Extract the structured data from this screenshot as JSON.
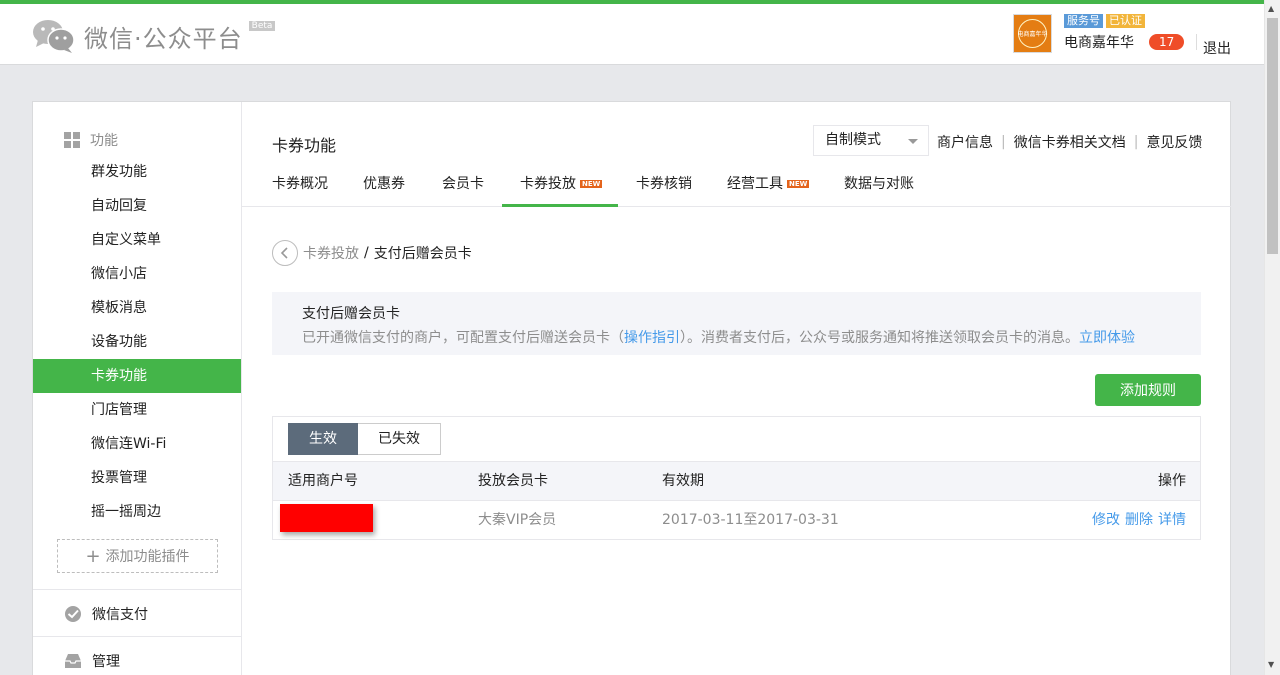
{
  "header": {
    "logo_text": "微信·公众平台",
    "beta": "Beta",
    "avatar_text": "电商嘉年华",
    "badge_service": "服务号",
    "badge_verified": "已认证",
    "account_name": "电商嘉年华",
    "message_count": "17",
    "logout": "退出"
  },
  "sidebar": {
    "section_title": "功能",
    "items": [
      {
        "label": "群发功能"
      },
      {
        "label": "自动回复"
      },
      {
        "label": "自定义菜单"
      },
      {
        "label": "微信小店"
      },
      {
        "label": "模板消息"
      },
      {
        "label": "设备功能"
      },
      {
        "label": "卡券功能"
      },
      {
        "label": "门店管理"
      },
      {
        "label": "微信连Wi-Fi"
      },
      {
        "label": "投票管理"
      },
      {
        "label": "摇一摇周边"
      }
    ],
    "add_plugin": "添加功能插件",
    "pay": "微信支付",
    "manage": "管理"
  },
  "content": {
    "title": "卡券功能",
    "mode_select": "自制模式",
    "links": [
      "商户信息",
      "微信卡券相关文档",
      "意见反馈"
    ],
    "tabs": [
      {
        "label": "卡券概况"
      },
      {
        "label": "优惠券"
      },
      {
        "label": "会员卡"
      },
      {
        "label": "卡券投放"
      },
      {
        "label": "卡券核销"
      },
      {
        "label": "经营工具"
      },
      {
        "label": "数据与对账"
      }
    ],
    "new_tag": "NEW",
    "breadcrumb": {
      "parent": "卡券投放",
      "sep": "/",
      "current": "支付后赠会员卡"
    },
    "info": {
      "title": "支付后赠会员卡",
      "desc_prefix": "已开通微信支付的商户，可配置支付后赠送会员卡（",
      "guide_link": "操作指引",
      "desc_middle": "）。消费者支付后，公众号或服务通知将推送领取会员卡的消息。",
      "try_link": "立即体验"
    },
    "add_rule": "添加规则",
    "filter": {
      "active": "生效",
      "expired": "已失效"
    },
    "table": {
      "headers": {
        "merchant": "适用商户号",
        "card": "投放会员卡",
        "period": "有效期",
        "ops": "操作"
      },
      "rows": [
        {
          "card": "大秦VIP会员",
          "period": "2017-03-11至2017-03-31"
        }
      ],
      "ops": {
        "edit": "修改",
        "delete": "删除",
        "detail": "详情"
      }
    }
  },
  "colors": {
    "brand_green": "#44b549",
    "link_blue": "#459ae9",
    "tab_selected": "#5c6b7b"
  }
}
